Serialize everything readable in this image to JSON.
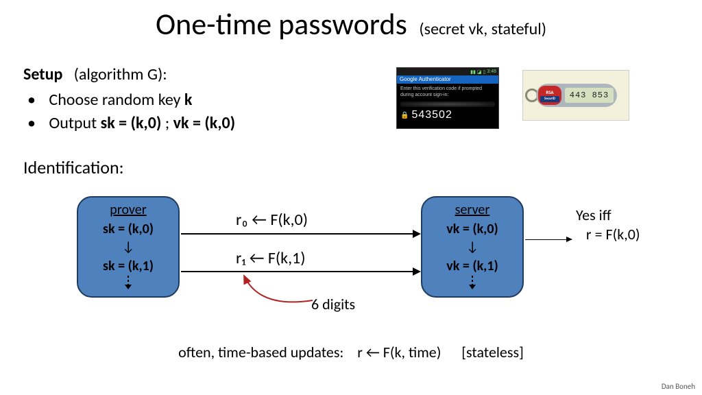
{
  "title": {
    "main": "One-time passwords",
    "sub": "(secret vk,   stateful)"
  },
  "setup": {
    "heading": "Setup",
    "heading_note": "(algorithm G)",
    "bullet1_pre": "Choose random key  ",
    "bullet1_key": "k",
    "bullet2_pre": "Output     ",
    "bullet2_sk": "sk = (k,0)",
    "bullet2_sep": "   ;     ",
    "bullet2_vk": "vk = (k,0)"
  },
  "phone": {
    "time": "3:48",
    "app": "Google Authenticator",
    "hint": "Enter this verification code if prompted during account sign-in:",
    "code": "543502"
  },
  "token": {
    "logo": "RSA",
    "sub": "SecurID",
    "digits": "443 853"
  },
  "ident": "Identification:",
  "prover": {
    "role": "prover",
    "s0": "sk = (k,0)",
    "s1": "sk = (k,1)"
  },
  "server": {
    "role": "server",
    "s0": "vk = (k,0)",
    "s1": "vk = (k,1)"
  },
  "arrows": {
    "r0": "r₀ ← F(k,0)",
    "r1": "r₁ ← F(k,1)"
  },
  "verify": {
    "line1": "Yes iff",
    "line2": "   r = F(k,0)"
  },
  "six": "6 digits",
  "footer": "often, time-based updates:    r ← F(k, time)      [stateless]",
  "author": "Dan Boneh",
  "down_glyph": "↓"
}
